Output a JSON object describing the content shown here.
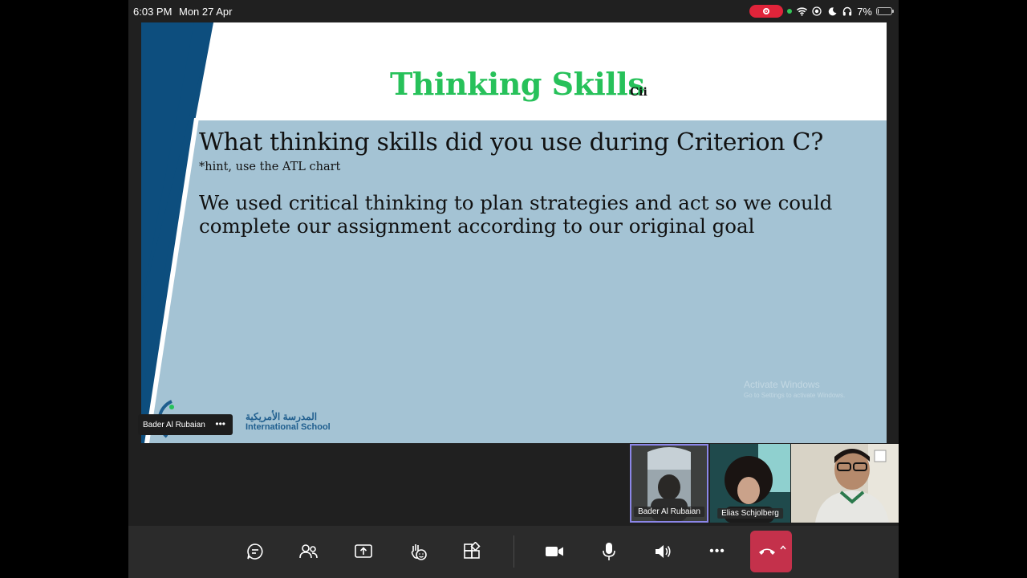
{
  "status_bar": {
    "time": "6:03 PM",
    "date": "Mon 27 Apr",
    "battery_percent": "7%",
    "battery_level": 0.07,
    "icons": [
      "record-icon",
      "wifi-icon",
      "screen-record-icon",
      "moon-icon",
      "headphones-icon",
      "battery-icon"
    ]
  },
  "slide": {
    "title": "Thinking Skills",
    "title_suffix": "Cii",
    "question": "What thinking skills did you use during Criterion C?",
    "hint": "*hint, use the ATL chart",
    "answer": "We used critical thinking to plan strategies and act so we could complete our assignment according to our original goal",
    "watermark_title": "Activate Windows",
    "watermark_subtitle": "Go to Settings to activate Windows.",
    "logo_arabic": "المدرسة الأمريكية",
    "logo_english": "International School",
    "colors": {
      "title": "#27c15a",
      "background": "#a4c3d4",
      "band": "#0d4e7e"
    }
  },
  "presenter": {
    "name": "Bader Al Rubaian",
    "more_label": "•••"
  },
  "participants": [
    {
      "name": "Bader Al Rubaian",
      "active": true
    },
    {
      "name": "Elias Schjolberg",
      "active": false
    },
    {
      "name": "",
      "active": false
    }
  ],
  "toolbar": {
    "buttons": [
      "chat-icon",
      "people-icon",
      "share-screen-icon",
      "raise-hand-icon",
      "apps-icon",
      "camera-icon",
      "microphone-icon",
      "speaker-icon",
      "more-icon",
      "leave-call-icon"
    ],
    "more_label": "•••",
    "leave_color": "#c4314b"
  }
}
